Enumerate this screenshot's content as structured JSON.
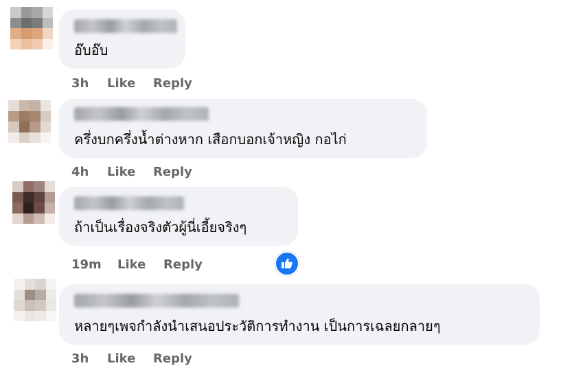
{
  "comments": [
    {
      "text": "อ๊บอ๊บ",
      "time": "3h",
      "like": "Like",
      "reply": "Reply"
    },
    {
      "text": "ครึ่งบกครึ่งน้ำต่างหาก เสือกบอกเจ้าหญิง กอไก่",
      "time": "4h",
      "like": "Like",
      "reply": "Reply"
    },
    {
      "text": "ถ้าเป็นเรื่องจริงตัวผู้นี่เอี้ยจริงๆ",
      "time": "19m",
      "like": "Like",
      "reply": "Reply",
      "reaction": "like-reaction-icon"
    },
    {
      "text": "หลายๆเพจกำลังนำเสนอประวัติการทำงาน เป็นการเฉลยกลายๆ",
      "time": "3h",
      "like": "Like",
      "reply": "Reply"
    }
  ],
  "colors": {
    "bubble": "#f0f2f5",
    "meta": "#65676b",
    "like_blue": "#1877f2"
  }
}
